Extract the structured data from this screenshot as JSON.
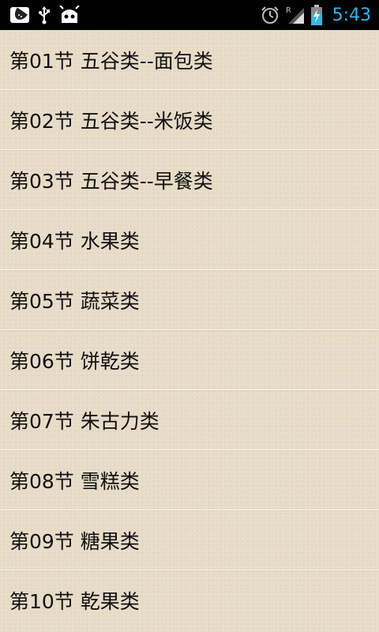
{
  "status_bar": {
    "time": "5:43",
    "network_roaming": "R",
    "icons": [
      "watermelon-app-icon",
      "usb-icon",
      "android-debug-icon",
      "alarm-icon",
      "signal-icon",
      "battery-charging-icon"
    ],
    "colors": {
      "background": "#000000",
      "clock": "#33b5e5"
    }
  },
  "list": {
    "items": [
      {
        "label": "第01节  五谷类--面包类"
      },
      {
        "label": "第02节  五谷类--米饭类"
      },
      {
        "label": "第03节  五谷类--早餐类"
      },
      {
        "label": "第04节  水果类"
      },
      {
        "label": "第05节  蔬菜类"
      },
      {
        "label": "第06节  饼乾类"
      },
      {
        "label": "第07节  朱古力类"
      },
      {
        "label": "第08节  雪糕类"
      },
      {
        "label": "第09节  糖果类"
      },
      {
        "label": "第10节  乾果类"
      }
    ]
  },
  "colors": {
    "background": "#e6dcc6",
    "text": "#111111"
  }
}
